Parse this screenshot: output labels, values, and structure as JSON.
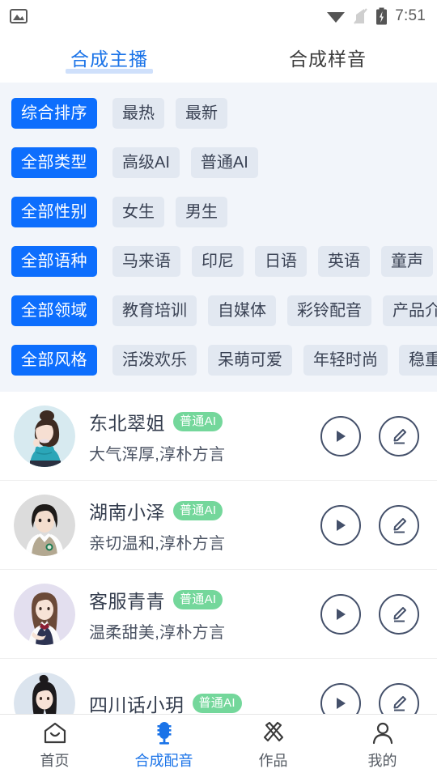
{
  "status_bar": {
    "time": "7:51",
    "icons": [
      "image-icon",
      "wifi-icon",
      "no-signal-icon",
      "battery-charging-icon"
    ]
  },
  "tabs": [
    {
      "label": "合成主播",
      "active": true
    },
    {
      "label": "合成样音",
      "active": false
    }
  ],
  "filters": [
    {
      "head": "综合排序",
      "options": [
        "最热",
        "最新"
      ]
    },
    {
      "head": "全部类型",
      "options": [
        "高级AI",
        "普通AI"
      ]
    },
    {
      "head": "全部性别",
      "options": [
        "女生",
        "男生"
      ]
    },
    {
      "head": "全部语种",
      "options": [
        "马来语",
        "印尼",
        "日语",
        "英语",
        "童声"
      ]
    },
    {
      "head": "全部领域",
      "options": [
        "教育培训",
        "自媒体",
        "彩铃配音",
        "产品介绍"
      ]
    },
    {
      "head": "全部风格",
      "options": [
        "活泼欢乐",
        "呆萌可爱",
        "年轻时尚",
        "稳重大气"
      ]
    }
  ],
  "voices": [
    {
      "name": "东北翠姐",
      "badge": "普通AI",
      "desc": "大气浑厚,淳朴方言",
      "avatar": {
        "bg": "#d7eaf0",
        "hair": "#3d2b22",
        "skin": "#f6dfd2",
        "cloth": "#2ba6b8"
      }
    },
    {
      "name": "湖南小泽",
      "badge": "普通AI",
      "desc": "亲切温和,淳朴方言",
      "avatar": {
        "bg": "#dcdcdc",
        "hair": "#1d1a18",
        "skin": "#f3ddcd",
        "cloth": "#b3a891"
      }
    },
    {
      "name": "客服青青",
      "badge": "普通AI",
      "desc": "温柔甜美,淳朴方言",
      "avatar": {
        "bg": "#e3dfef",
        "hair": "#6b4a38",
        "skin": "#f7e3d6",
        "cloth": "#2d3352"
      }
    },
    {
      "name": "四川话小玥",
      "badge": "普通AI",
      "desc": "",
      "avatar": {
        "bg": "#dbe4ee",
        "hair": "#1c1a1c",
        "skin": "#f7e2d6",
        "cloth": "#e9ece8"
      }
    }
  ],
  "bottom_nav": [
    {
      "label": "首页",
      "icon": "home-icon",
      "active": false
    },
    {
      "label": "合成配音",
      "icon": "microphone-icon",
      "active": true
    },
    {
      "label": "作品",
      "icon": "pen-ruler-icon",
      "active": false
    },
    {
      "label": "我的",
      "icon": "person-icon",
      "active": false
    }
  ],
  "colors": {
    "accent": "#0d6efd",
    "tab_active": "#1a73e8",
    "badge_green": "#74d79b",
    "chip_bg": "#e2e8f1",
    "panel_bg": "#f2f5fa"
  }
}
